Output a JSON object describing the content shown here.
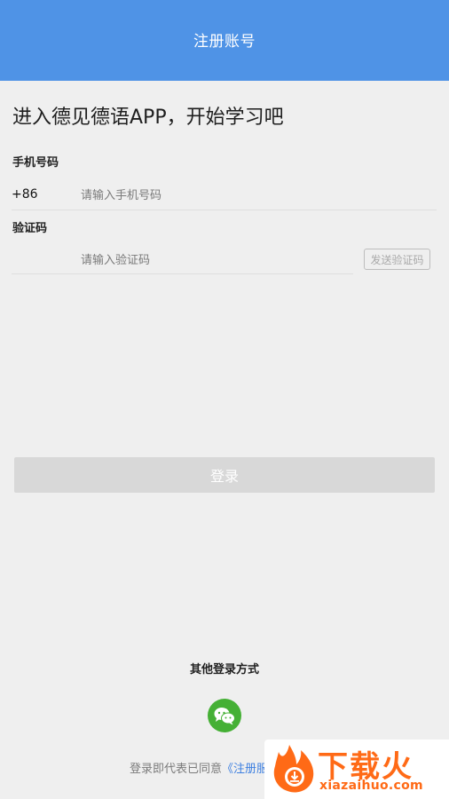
{
  "header": {
    "title": "注册账号"
  },
  "headline": "进入德见德语APP，开始学习吧",
  "phone": {
    "label": "手机号码",
    "country_code": "+86",
    "placeholder": "请输入手机号码"
  },
  "code": {
    "label": "验证码",
    "placeholder": "请输入验证码",
    "send_button": "发送验证码"
  },
  "login_button": "登录",
  "other_login": {
    "label": "其他登录方式",
    "icon": "wechat-icon",
    "icon_color": "#45b035"
  },
  "agreement": {
    "prefix": "登录即代表已同意",
    "link": "《注册服"
  },
  "watermark": {
    "title": "下载火",
    "subtitle": "xiazaihuo.com"
  },
  "colors": {
    "header": "#4f93e6",
    "link": "#3d7fe0",
    "watermark": "#ff6a16"
  }
}
